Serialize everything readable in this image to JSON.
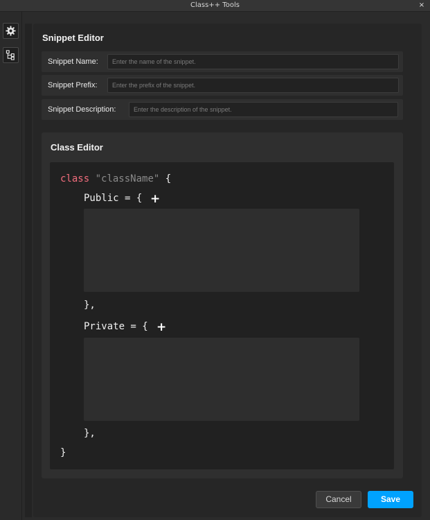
{
  "window": {
    "title": "Class++ Tools",
    "close_glyph": "×"
  },
  "sidebar": {
    "items": [
      {
        "icon": "gear-icon"
      },
      {
        "icon": "hierarchy-icon"
      }
    ]
  },
  "snippet_editor": {
    "heading": "Snippet Editor",
    "fields": [
      {
        "label": "Snippet Name:",
        "placeholder": "Enter the name of the snippet."
      },
      {
        "label": "Snippet Prefix:",
        "placeholder": "Enter the prefix of the snippet."
      },
      {
        "label": "Snippet Description:",
        "placeholder": "Enter the description of the snippet."
      }
    ]
  },
  "class_editor": {
    "heading": "Class Editor",
    "keyword": "class",
    "class_name": "\"className\"",
    "open_brace": "{",
    "public_label": "Public = {",
    "private_label": "Private = {",
    "add_glyph": "+",
    "section_close": "},",
    "close_brace": "}"
  },
  "actions": {
    "cancel_label": "Cancel",
    "save_label": "Save"
  },
  "colors": {
    "accent": "#00a2ff",
    "keyword": "#f26d7d",
    "string": "#8a8a8a"
  }
}
